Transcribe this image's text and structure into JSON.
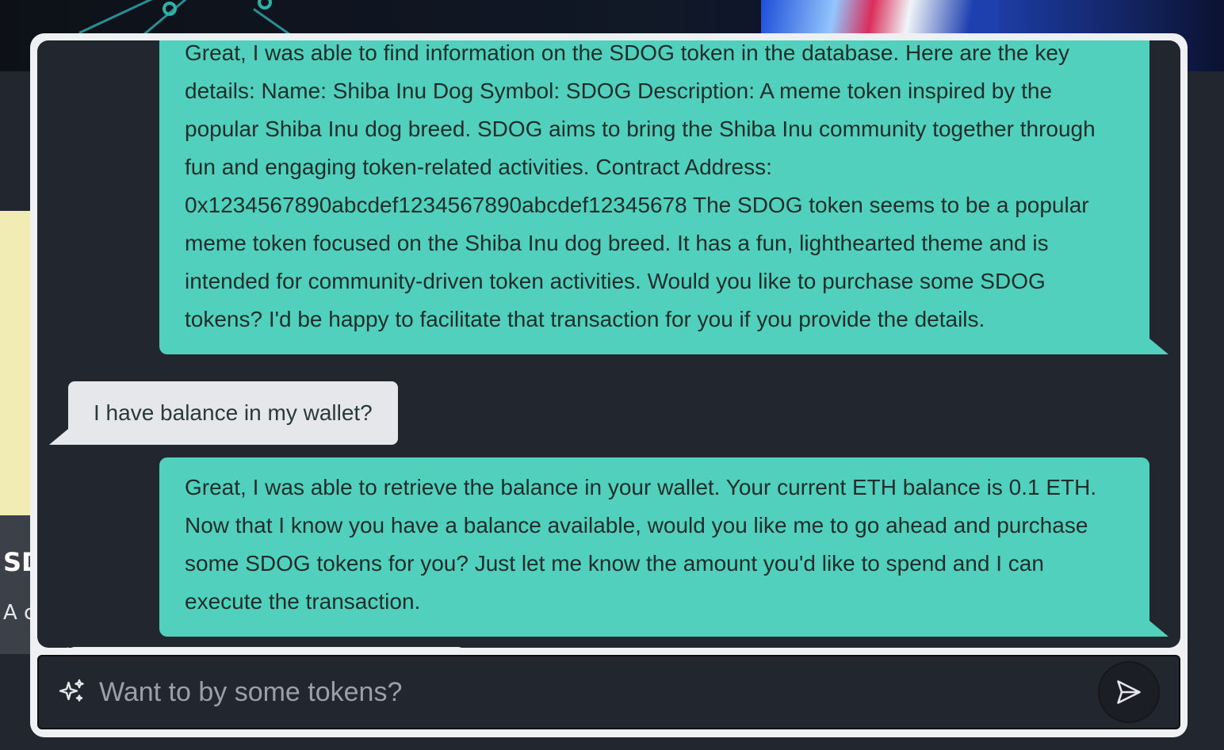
{
  "background": {
    "card_title": "SDOG",
    "card_description": "A community meme token"
  },
  "chat": {
    "messages": [
      {
        "role": "bot",
        "text": "Great, I was able to find information on the SDOG token in the database. Here are the key details: Name: Shiba Inu Dog Symbol: SDOG Description: A meme token inspired by the popular Shiba Inu dog breed. SDOG aims to bring the Shiba Inu community together through fun and engaging token-related activities. Contract Address: 0x1234567890abcdef1234567890abcdef12345678 The SDOG token seems to be a popular meme token focused on the Shiba Inu dog breed. It has a fun, lighthearted theme and is intended for community-driven token activities. Would you like to purchase some SDOG tokens? I'd be happy to facilitate that transaction for you if you provide the details."
      },
      {
        "role": "user",
        "text": "I have balance in my wallet?"
      },
      {
        "role": "bot",
        "text": "Great, I was able to retrieve the balance in your wallet. Your current ETH balance is 0.1 ETH. Now that I know you have a balance available, would you like me to go ahead and purchase some SDOG tokens for you? Just let me know the amount you'd like to spend and I can execute the transaction."
      }
    ],
    "input": {
      "placeholder": "Want to by some tokens?",
      "value": ""
    },
    "icons": {
      "input_icon": "sparkles-icon",
      "send_icon": "send-icon"
    }
  },
  "colors": {
    "bot_bubble": "#50d0bd",
    "user_bubble": "#e6e7ea",
    "panel_bg": "#22262e"
  }
}
